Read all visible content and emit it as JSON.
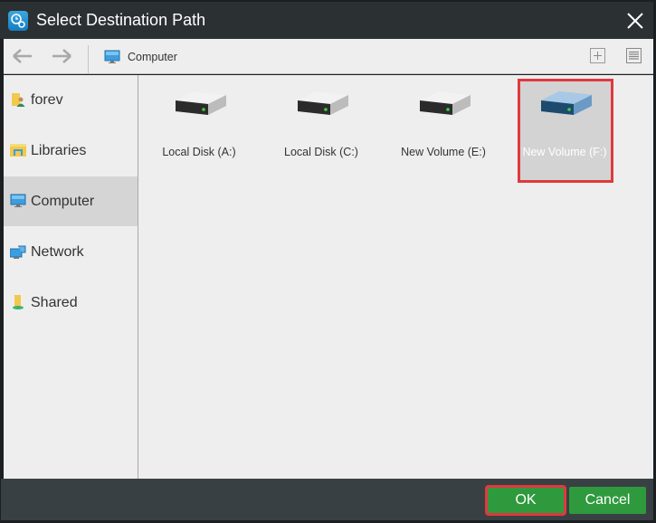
{
  "window": {
    "title": "Select Destination Path",
    "app_icon": "clock-gear-icon",
    "close_icon": "close-icon"
  },
  "toolbar": {
    "back_icon": "arrow-left-icon",
    "forward_icon": "arrow-right-icon",
    "breadcrumb_icon": "computer-icon",
    "breadcrumb_label": "Computer",
    "new_folder_icon": "plus-icon",
    "view_icon": "list-view-icon"
  },
  "sidebar": {
    "items": [
      {
        "label": "forev",
        "icon": "user-folder-icon",
        "active": false
      },
      {
        "label": "Libraries",
        "icon": "library-folder-icon",
        "active": false
      },
      {
        "label": "Computer",
        "icon": "computer-icon",
        "active": true
      },
      {
        "label": "Network",
        "icon": "network-icon",
        "active": false
      },
      {
        "label": "Shared",
        "icon": "shared-folder-icon",
        "active": false
      }
    ]
  },
  "drives": [
    {
      "label": "Local Disk (A:)",
      "icon": "hard-drive-icon",
      "selected": false
    },
    {
      "label": "Local Disk (C:)",
      "icon": "hard-drive-icon",
      "selected": false
    },
    {
      "label": "New Volume (E:)",
      "icon": "hard-drive-icon",
      "selected": false
    },
    {
      "label": "New Volume (F:)",
      "icon": "hard-drive-icon",
      "selected": true
    }
  ],
  "footer": {
    "ok_label": "OK",
    "cancel_label": "Cancel"
  },
  "colors": {
    "titlebar": "#2b3033",
    "footer": "#394043",
    "button_green": "#2f9a3d",
    "highlight_red": "#e0393e",
    "panel": "#eeeeee",
    "selected": "#d5d5d5"
  }
}
